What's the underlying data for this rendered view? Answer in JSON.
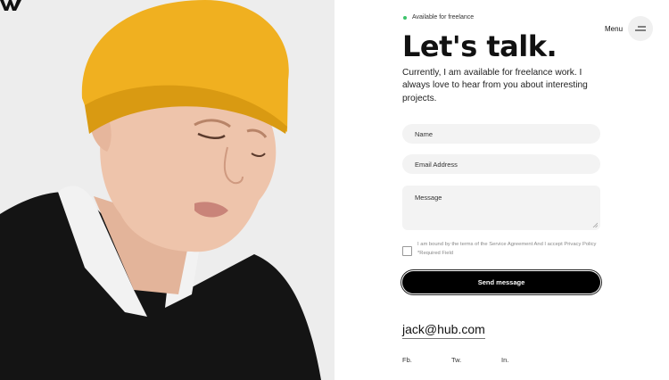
{
  "header": {
    "status": "Available for freelance",
    "menu_label": "Menu",
    "logo_icon": "w-logo-icon",
    "menu_icon": "menu-icon"
  },
  "contact": {
    "title": "Let's talk.",
    "intro": "Currently, I am available for freelance work. I always love to hear from you about interesting projects."
  },
  "form": {
    "name_placeholder": "Name",
    "email_placeholder": "Email Address",
    "message_placeholder": "Message",
    "consent": "I am bound by the terms of the Service Agreement And I accept Privacy Policy *Required Field",
    "consent_checked": false,
    "submit_label": "Send message"
  },
  "footer": {
    "email": "jack@hub.com",
    "socials": [
      "Fb.",
      "Tw.",
      "In."
    ]
  },
  "colors": {
    "status_dot": "#3cc36a",
    "beanie": "#f0b020",
    "button": "#000000"
  }
}
